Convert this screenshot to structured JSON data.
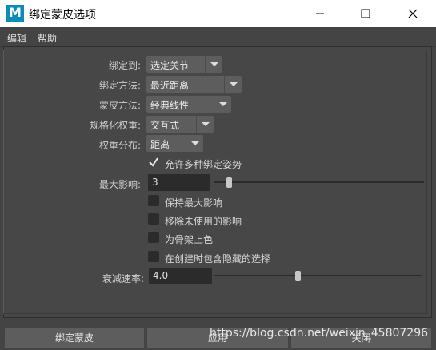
{
  "window": {
    "title": "绑定蒙皮选项",
    "app_icon_letter": "M"
  },
  "menu": {
    "items": [
      "编辑",
      "帮助"
    ]
  },
  "form": {
    "bind_to": {
      "label": "绑定到:",
      "value": "选定关节"
    },
    "bind_method": {
      "label": "绑定方法:",
      "value": "最近距离"
    },
    "skin_method": {
      "label": "蒙皮方法:",
      "value": "经典线性"
    },
    "normalize_weights": {
      "label": "规格化权重:",
      "value": "交互式"
    },
    "weight_distribution": {
      "label": "权重分布:",
      "value": "距离"
    },
    "allow_multiple_poses": {
      "label": "允许多种绑定姿势",
      "checked": true
    },
    "max_influences": {
      "label": "最大影响:",
      "value": "3",
      "slider_fraction": 0.07
    },
    "maintain_max_influences": {
      "label": "保持最大影响",
      "checked": false
    },
    "remove_unused_influences": {
      "label": "移除未使用的影响",
      "checked": false
    },
    "colorize_skeleton": {
      "label": "为骨架上色",
      "checked": false
    },
    "include_hidden": {
      "label": "在创建时包含隐藏的选择",
      "checked": false
    },
    "dropoff_rate": {
      "label": "衰减速率:",
      "value": "4.0",
      "slider_fraction": 0.4
    }
  },
  "buttons": {
    "bind": "绑定蒙皮",
    "apply": "应用",
    "close": "关闭"
  },
  "watermark": "https://blog.csdn.net/weixin_45807296",
  "colors": {
    "background": "#444444",
    "field": "#2b2b2b",
    "dropdown": "#5d5d5d",
    "app_icon": "#0a8cb8"
  }
}
